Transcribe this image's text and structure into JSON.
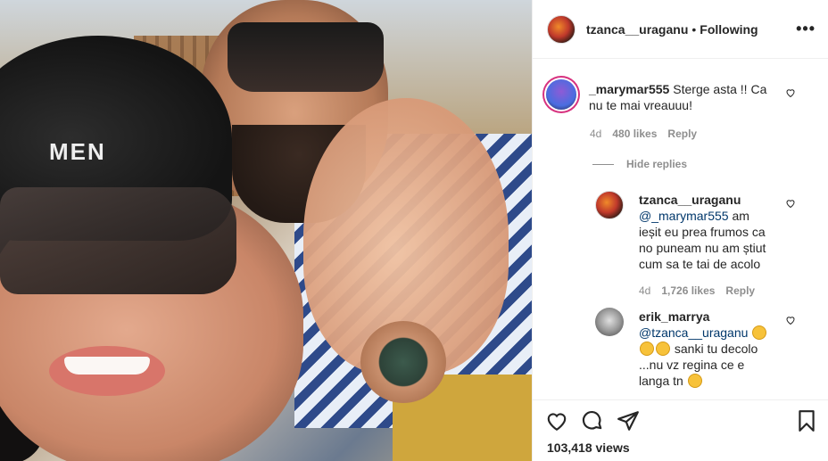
{
  "post": {
    "author": "tzanca__uraganu",
    "separator": "•",
    "follow_status": "Following",
    "more_label": "•••",
    "media_hat_text": "MEN",
    "views": "103,418 views"
  },
  "comments": [
    {
      "user": "_marymar555",
      "text": "Sterge asta !! Ca nu te mai vreauuu!",
      "age": "4d",
      "likes": "480 likes",
      "reply": "Reply"
    }
  ],
  "hide_replies_label": "Hide replies",
  "replies": [
    {
      "user": "tzanca__uraganu",
      "mention": "@_marymar555",
      "text": " am ieșit eu prea frumos ca no puneam nu am știut cum sa te tai de acolo",
      "age": "4d",
      "likes": "1,726 likes",
      "reply": "Reply"
    },
    {
      "user": "erik_marrya",
      "mention": "@tzanca__uraganu",
      "text_line2": " sanki tu decolo ...nu vz regina ce e langa tn"
    }
  ],
  "icons": {
    "like": "heart-icon",
    "comment": "comment-icon",
    "share": "share-icon",
    "save": "bookmark-icon",
    "more": "more-horizontal-icon"
  }
}
